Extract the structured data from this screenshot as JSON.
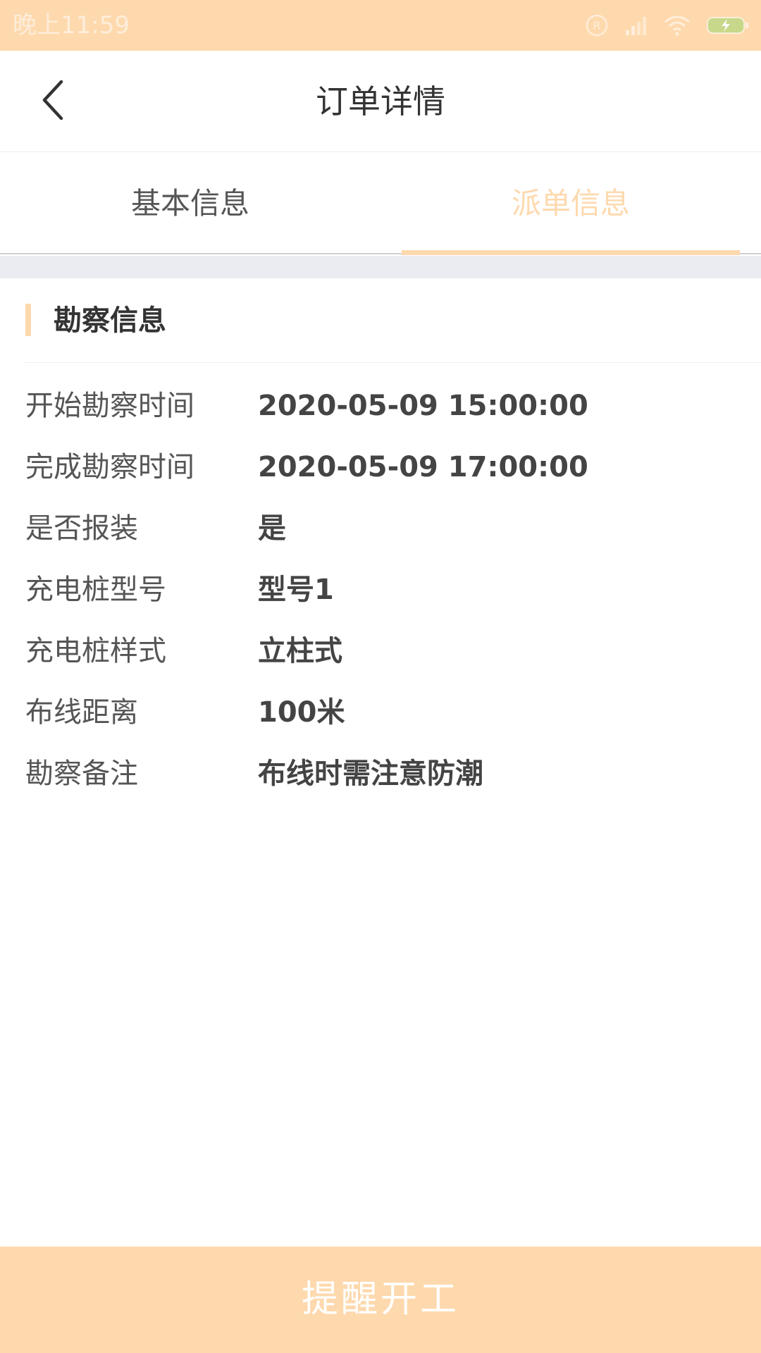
{
  "status_bar": {
    "time": "晚上11:59",
    "icons": [
      "r-icon",
      "signal-icon",
      "wifi-icon",
      "battery-charging-icon"
    ]
  },
  "header": {
    "title": "订单详情",
    "back_icon": "chevron-left-icon"
  },
  "tabs": [
    {
      "label": "基本信息",
      "active": false
    },
    {
      "label": "派单信息",
      "active": true
    }
  ],
  "section": {
    "title": "勘察信息"
  },
  "info_rows": [
    {
      "label": "开始勘察时间",
      "value": "2020-05-09 15:00:00"
    },
    {
      "label": "完成勘察时间",
      "value": "2020-05-09 17:00:00"
    },
    {
      "label": "是否报装",
      "value": "是"
    },
    {
      "label": "充电桩型号",
      "value": "型号1"
    },
    {
      "label": "充电桩样式",
      "value": "立柱式"
    },
    {
      "label": "布线距离",
      "value": "100米"
    },
    {
      "label": "勘察备注",
      "value": "布线时需注意防潮"
    }
  ],
  "footer": {
    "button_label": "提醒开工"
  },
  "colors": {
    "accent": "#fed9ae",
    "page_background": "#ffffff",
    "section_gap": "#eaecf2"
  }
}
